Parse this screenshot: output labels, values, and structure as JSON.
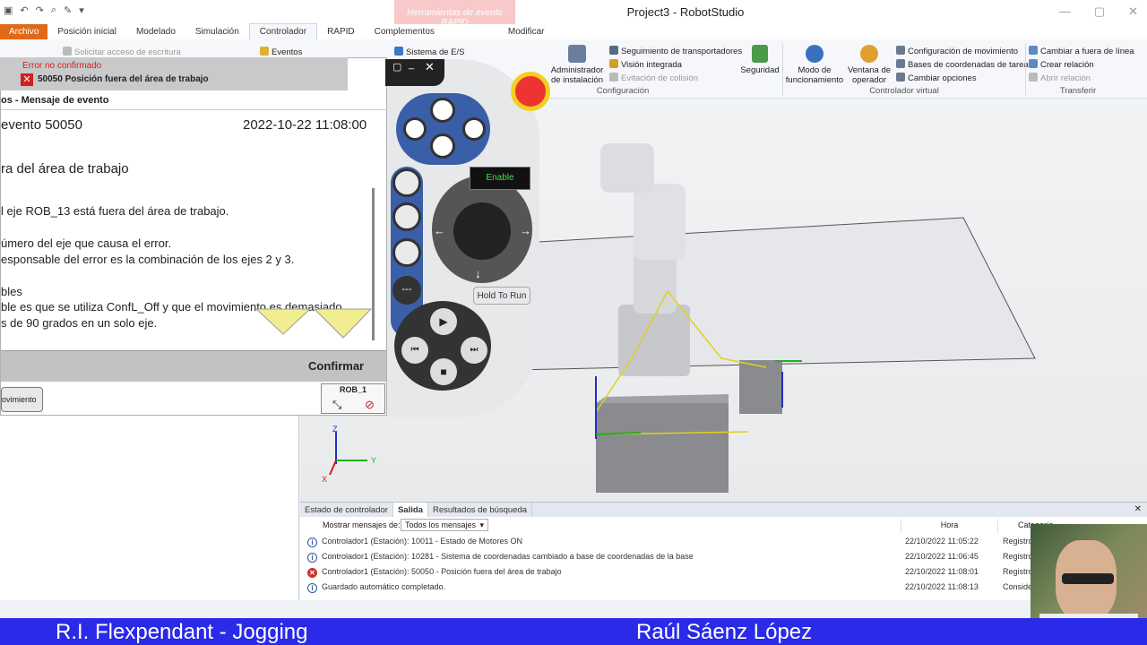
{
  "window": {
    "title": "Project3 - RobotStudio",
    "context_tab": "Herramientas de evento RAPID"
  },
  "tabs": [
    "Archivo",
    "Posición inicial",
    "Modelado",
    "Simulación",
    "Controlador",
    "RAPID",
    "Complementos",
    "Modificar"
  ],
  "ribbon": {
    "request_write": "Solicitar acceso de escritura",
    "events": "Eventos",
    "io_system": "Sistema de E/S",
    "install_mgr": "Administrador de instalación",
    "conveyor": "Seguimiento de transportadores",
    "vision": "Visión integrada",
    "collision": "Evitación de colisión",
    "group_config": "Configuración",
    "security": "Seguridad",
    "op_mode": "Modo de funcionamiento",
    "op_window": "Ventana de operador",
    "motion_cfg": "Configuración de movimiento",
    "task_frames": "Bases de coordenadas de tarea",
    "change_opts": "Cambiar opciones",
    "group_vc": "Controlador virtual",
    "change_offline": "Cambiar a fuera de línea",
    "create_rel": "Crear relación",
    "open_rel": "Abrir relación",
    "group_transfer": "Transferir"
  },
  "flexpendant": {
    "error_title": "Error no confirmado",
    "error_msg": "50050 Posición fuera del área de trabajo",
    "header": "os - Mensaje de evento",
    "event_no": "evento 50050",
    "timestamp": "2022-10-22 11:08:00",
    "event_title": "ra del área de trabajo",
    "line1": "l eje ROB_13 está fuera del área de trabajo.",
    "line2": "úmero del eje que causa el error.",
    "line3": "esponsable del error es la combinación de los ejes 2 y 3.",
    "line4": "bles",
    "line5": "ble es que se utiliza ConfL_Off y que el movimiento es demasiado",
    "line6": "s de 90 grados en un solo eje.",
    "confirm": "Confirmar",
    "movement_btn": "ovimiento",
    "rob": "ROB_1",
    "enable": "Enable",
    "hold": "Hold To Run"
  },
  "viewport": {
    "axis_x": "X",
    "axis_y": "Y",
    "axis_z": "Z"
  },
  "output": {
    "tabs": [
      "Estado de controlador",
      "Salida",
      "Resultados de búsqueda"
    ],
    "filter_label": "Mostrar mensajes de:",
    "filter_value": "Todos los mensajes",
    "col_time": "Hora",
    "col_cat": "Categoría",
    "rows": [
      {
        "type": "info",
        "msg": "Controlador1 (Estación): 10011 - Estado de Motores ON",
        "time": "22/10/2022 11:05:22",
        "cat": "Registro"
      },
      {
        "type": "info",
        "msg": "Controlador1 (Estación): 10281 - Sistema de coordenadas cambiado a base de coordenadas de la base",
        "time": "22/10/2022 11:06:45",
        "cat": "Registro"
      },
      {
        "type": "error",
        "msg": "Controlador1 (Estación): 50050 - Posición fuera del área de trabajo",
        "time": "22/10/2022 11:08:01",
        "cat": "Registro"
      },
      {
        "type": "info",
        "msg": "Guardado automático completado.",
        "time": "22/10/2022 11:08:13",
        "cat": "Conside"
      }
    ]
  },
  "banner": {
    "left": "R.I. Flexpendant - Jogging",
    "right": "Raúl Sáenz López"
  }
}
